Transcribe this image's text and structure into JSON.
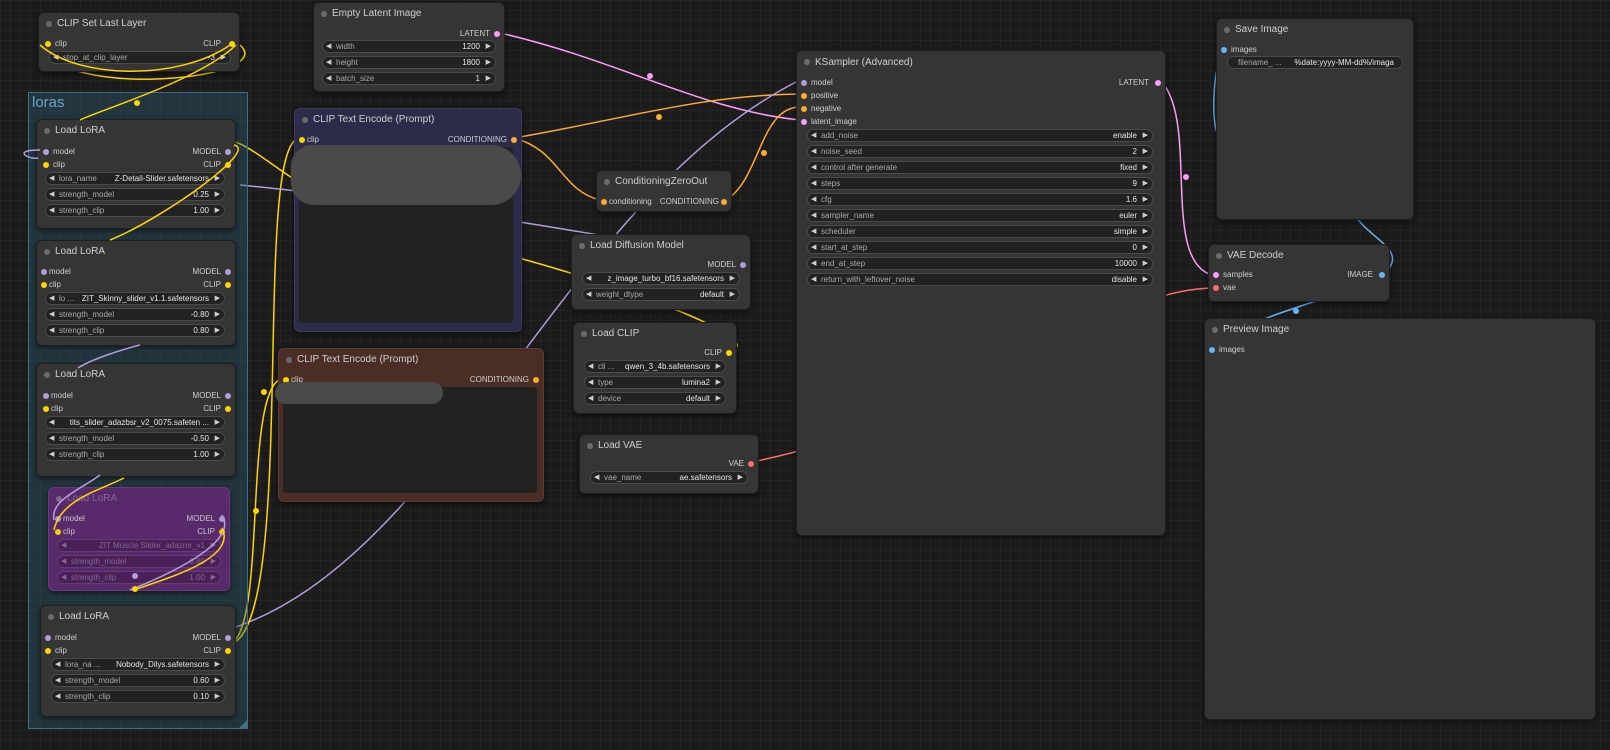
{
  "colors": {
    "model": "#b39ddb",
    "clip": "#ffd500",
    "conditioning": "#ffa931",
    "latent": "#ff9cf9",
    "vae": "#ff6e6e",
    "image": "#64b5f6",
    "group": "#3d6f88",
    "node_bg": "#353535",
    "bypassed": "#5c2a6e"
  },
  "group": {
    "title": "loras"
  },
  "clip_set_last_layer": {
    "title": "CLIP Set Last Layer",
    "in_clip": "clip",
    "out_clip": "CLIP",
    "w1_label": "stop_at_clip_layer",
    "w1_value": "-3"
  },
  "lora1": {
    "title": "Load LoRA",
    "in_model": "model",
    "in_clip": "clip",
    "out_model": "MODEL",
    "out_clip": "CLIP",
    "w1_label": "lora_name",
    "w1_value": "Z-Detail-Slider.safetensors",
    "w2_label": "strength_model",
    "w2_value": "0.25",
    "w3_label": "strength_clip",
    "w3_value": "1.00"
  },
  "lora2": {
    "title": "Load LoRA",
    "in_model": "model",
    "in_clip": "clip",
    "out_model": "MODEL",
    "out_clip": "CLIP",
    "w1_label": "lo ...",
    "w1_value": "ZIT_Skinny_slider_v1.1.safetensors",
    "w2_label": "strength_model",
    "w2_value": "-0.80",
    "w3_label": "strength_clip",
    "w3_value": "0.80"
  },
  "lora3": {
    "title": "Load LoRA",
    "in_model": "model",
    "in_clip": "clip",
    "out_model": "MODEL",
    "out_clip": "CLIP",
    "w1_label": "",
    "w1_value": "tits_slider_adazbsr_v2_0075.safeten ...",
    "w2_label": "strength_model",
    "w2_value": "-0.50",
    "w3_label": "strength_clip",
    "w3_value": "1.00"
  },
  "lora4": {
    "title": "Load LoRA",
    "in_model": "model",
    "in_clip": "clip",
    "out_model": "MODEL",
    "out_clip": "CLIP",
    "w1_label": "",
    "w1_value": "ZIT Muscle Slider_adazmr_v1",
    "w2_label": "strength_model",
    "w2_value": "0.80",
    "w3_label": "strength_clip",
    "w3_value": "1.00"
  },
  "lora5": {
    "title": "Load LoRA",
    "in_model": "model",
    "in_clip": "clip",
    "out_model": "MODEL",
    "out_clip": "CLIP",
    "w1_label": "lora_na ...",
    "w1_value": "Nobody_Dilys.safetensors",
    "w2_label": "strength_model",
    "w2_value": "0.60",
    "w3_label": "strength_clip",
    "w3_value": "0.10"
  },
  "empty_latent": {
    "title": "Empty Latent Image",
    "out_latent": "LATENT",
    "w1_label": "width",
    "w1_value": "1200",
    "w2_label": "height",
    "w2_value": "1800",
    "w3_label": "batch_size",
    "w3_value": "1"
  },
  "clip_text_pos": {
    "title": "CLIP Text Encode (Prompt)",
    "in_clip": "clip",
    "out": "CONDITIONING"
  },
  "clip_text_neg": {
    "title": "CLIP Text Encode (Prompt)",
    "in_clip": "clip",
    "out": "CONDITIONING"
  },
  "cond_zero": {
    "title": "ConditioningZeroOut",
    "in": "conditioning",
    "out": "CONDITIONING"
  },
  "diffusion": {
    "title": "Load Diffusion Model",
    "out_model": "MODEL",
    "w1_label": "",
    "w1_value": "z_image_turbo_bf16.safetensors",
    "w2_label": "weight_dtype",
    "w2_value": "default"
  },
  "load_clip": {
    "title": "Load CLIP",
    "out_clip": "CLIP",
    "w1_label": "cli ...",
    "w1_value": "qwen_3_4b.safetensors",
    "w2_label": "type",
    "w2_value": "lumina2",
    "w3_label": "device",
    "w3_value": "default"
  },
  "load_vae": {
    "title": "Load VAE",
    "out_vae": "VAE",
    "w1_label": "vae_name",
    "w1_value": "ae.safetensors"
  },
  "ksampler": {
    "title": "KSampler (Advanced)",
    "in_model": "model",
    "in_positive": "positive",
    "in_negative": "negative",
    "in_latent": "latent_image",
    "out_latent": "LATENT",
    "widgets": [
      {
        "label": "add_noise",
        "value": "enable"
      },
      {
        "label": "noise_seed",
        "value": "2"
      },
      {
        "label": "control after generate",
        "value": "fixed"
      },
      {
        "label": "steps",
        "value": "9"
      },
      {
        "label": "cfg",
        "value": "1.6"
      },
      {
        "label": "sampler_name",
        "value": "euler"
      },
      {
        "label": "scheduler",
        "value": "simple"
      },
      {
        "label": "start_at_step",
        "value": "0"
      },
      {
        "label": "end_at_step",
        "value": "10000"
      },
      {
        "label": "return_with_leftover_noise",
        "value": "disable"
      }
    ]
  },
  "save_image": {
    "title": "Save Image",
    "in_images": "images",
    "w1_label": "filename_ ...",
    "w1_value": "%date:yyyy-MM-dd%/imaga"
  },
  "vae_decode": {
    "title": "VAE Decode",
    "in_samples": "samples",
    "in_vae": "vae",
    "out_image": "IMAGE"
  },
  "preview_image": {
    "title": "Preview Image",
    "in_images": "images"
  }
}
